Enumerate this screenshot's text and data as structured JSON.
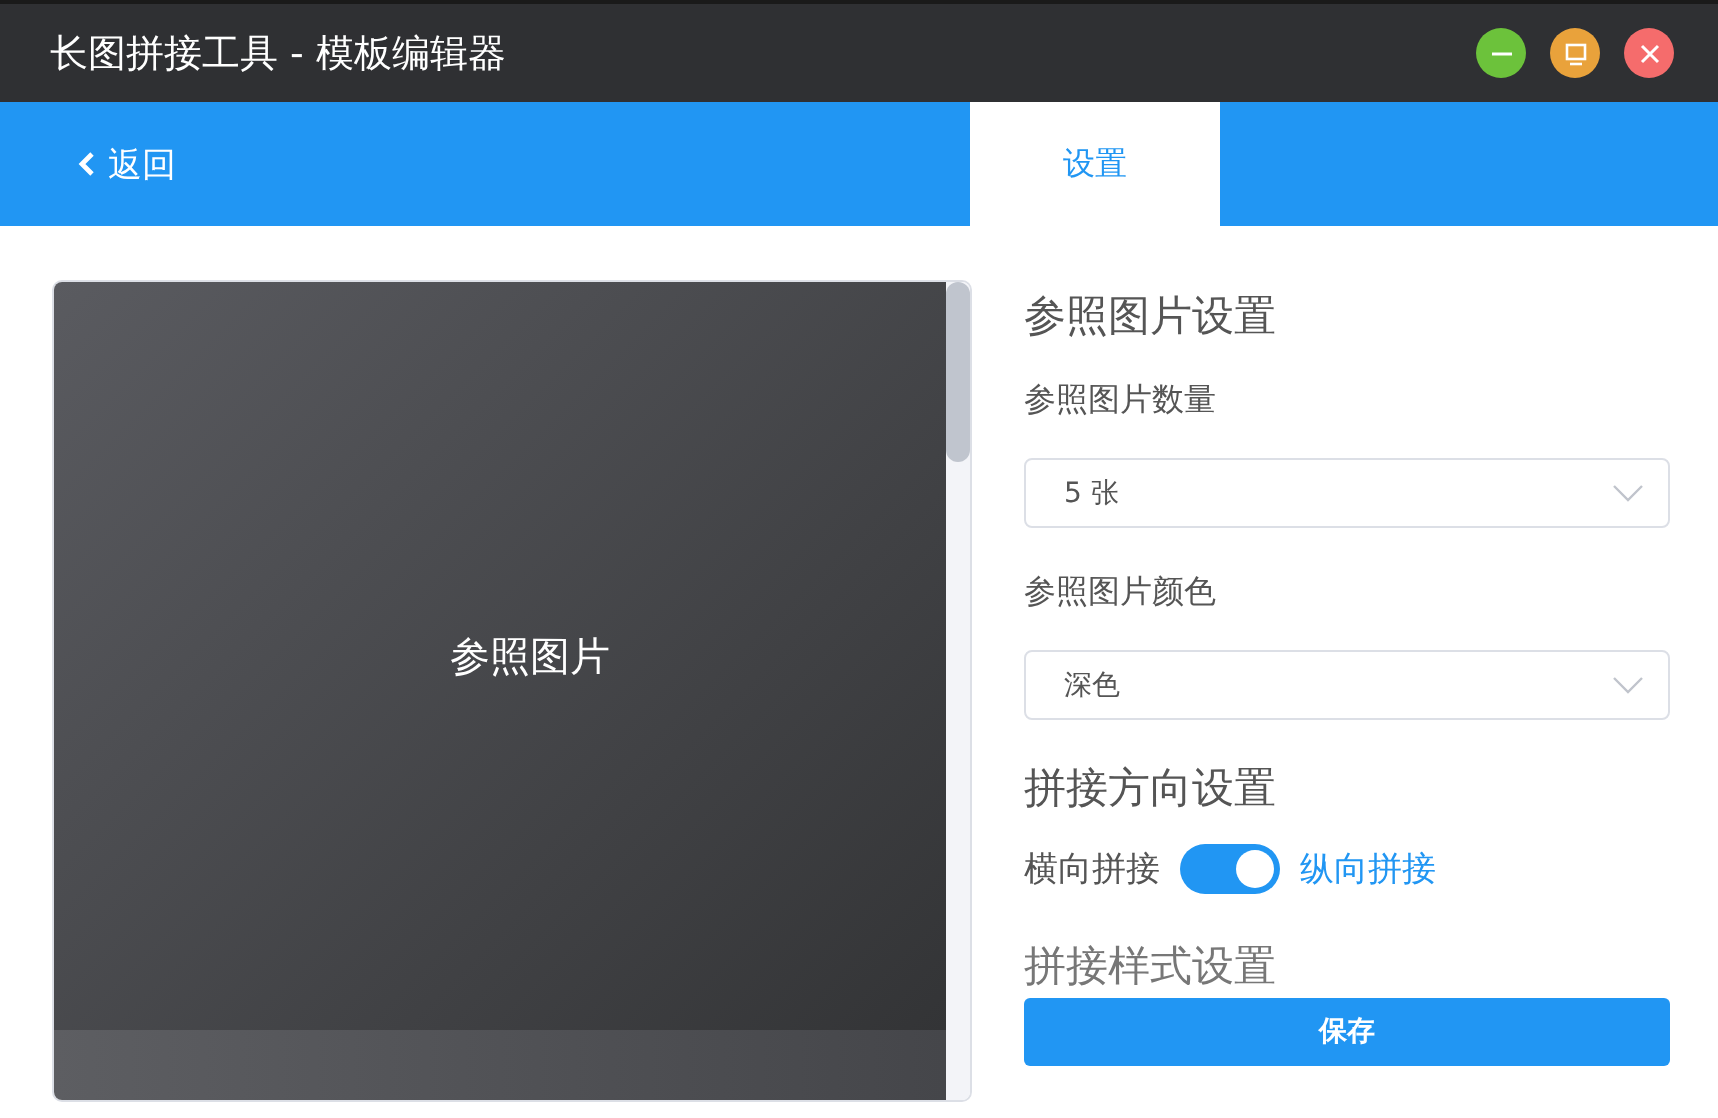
{
  "window": {
    "title": "长图拼接工具 - 模板编辑器"
  },
  "nav": {
    "back": "返回",
    "tabs": [
      {
        "label": "设置",
        "selected": true
      }
    ]
  },
  "preview": {
    "label": "参照图片"
  },
  "settings": {
    "sections": [
      {
        "kind": "heading",
        "text": "参照图片设置"
      },
      {
        "kind": "select",
        "label": "参照图片数量",
        "value": "5 张"
      },
      {
        "kind": "select",
        "label": "参照图片颜色",
        "value": "深色"
      },
      {
        "kind": "heading",
        "text": "拼接方向设置"
      },
      {
        "kind": "toggle",
        "off_label": "横向拼接",
        "on_label": "纵向拼接",
        "on": true
      },
      {
        "kind": "heading",
        "text": "拼接样式设置"
      }
    ],
    "save": "保存"
  }
}
